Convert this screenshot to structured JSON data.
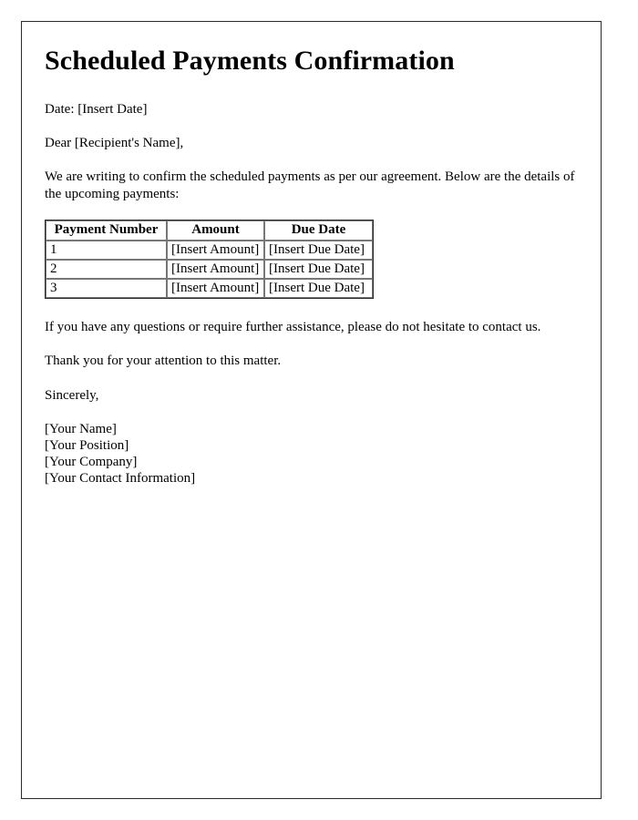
{
  "document": {
    "title": "Scheduled Payments Confirmation",
    "date_line": "Date: [Insert Date]",
    "salutation": "Dear [Recipient's Name],",
    "intro_paragraph": "We are writing to confirm the scheduled payments as per our agreement. Below are the details of the upcoming payments:",
    "closing_paragraph": "If you have any questions or require further assistance, please do not hesitate to contact us.",
    "thanks_paragraph": "Thank you for your attention to this matter.",
    "sign_off": "Sincerely,"
  },
  "payments_table": {
    "headers": [
      "Payment Number",
      "Amount",
      "Due Date"
    ],
    "rows": [
      [
        "1",
        "[Insert Amount]",
        "[Insert Due Date]"
      ],
      [
        "2",
        "[Insert Amount]",
        "[Insert Due Date]"
      ],
      [
        "3",
        "[Insert Amount]",
        "[Insert Due Date]"
      ]
    ]
  },
  "signature": {
    "lines": [
      "[Your Name]",
      "[Your Position]",
      "[Your Company]",
      "[Your Contact Information]"
    ]
  },
  "colors": {
    "page_background": "#ffffff",
    "text": "#000000",
    "page_border": "#2b2b2b",
    "cell_border": "#777777"
  }
}
